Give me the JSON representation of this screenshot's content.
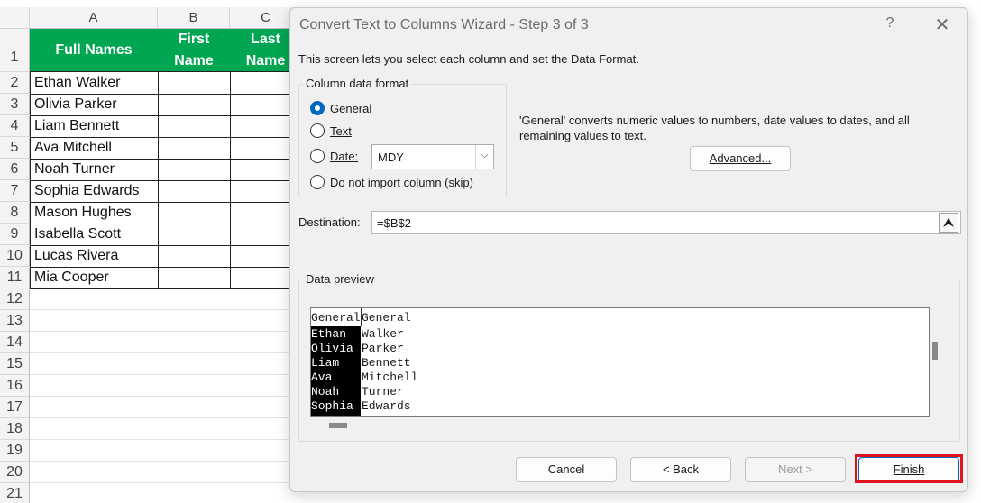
{
  "spreadsheet": {
    "columns": [
      "A",
      "B",
      "C"
    ],
    "rows": [
      "1",
      "2",
      "3",
      "4",
      "5",
      "6",
      "7",
      "8",
      "9",
      "10",
      "11",
      "12",
      "13",
      "14",
      "15",
      "16",
      "17",
      "18",
      "19",
      "20",
      "21"
    ],
    "headers": {
      "full_names": "Full Names",
      "first_name_1": "First",
      "first_name_2": "Name",
      "last_name_1": "Last",
      "last_name_2": "Name"
    },
    "names": [
      "Ethan Walker",
      "Olivia Parker",
      "Liam Bennett",
      "Ava Mitchell",
      "Noah Turner",
      "Sophia Edwards",
      "Mason Hughes",
      "Isabella Scott",
      "Lucas Rivera",
      "Mia Cooper"
    ],
    "header_color": "#00a651"
  },
  "dialog": {
    "title": "Convert Text to Columns Wizard - Step 3 of 3",
    "help": "?",
    "close": "✕",
    "intro": "This screen lets you select each column and set the Data Format.",
    "column_format": {
      "legend": "Column data format",
      "options": [
        "General",
        "Text",
        "Date:",
        "Do not import column (skip)"
      ],
      "selected": "General",
      "date_value": "MDY"
    },
    "description": "'General' converts numeric values to numbers, date values to dates, and all remaining values to text.",
    "advanced_label": "Advanced...",
    "destination_label": "Destination:",
    "destination_value": "=$B$2",
    "preview": {
      "legend": "Data preview",
      "headers": [
        "General",
        "General"
      ],
      "col1": [
        "Ethan",
        "Olivia",
        "Liam",
        "Ava",
        "Noah",
        "Sophia"
      ],
      "col2": [
        "Walker",
        "Parker",
        "Bennett",
        "Mitchell",
        "Turner",
        "Edwards"
      ]
    },
    "buttons": {
      "cancel": "Cancel",
      "back": "< Back",
      "next": "Next >",
      "finish": "Finish"
    },
    "highlight_color": "#e0141e",
    "accent_color": "#0067c0"
  }
}
